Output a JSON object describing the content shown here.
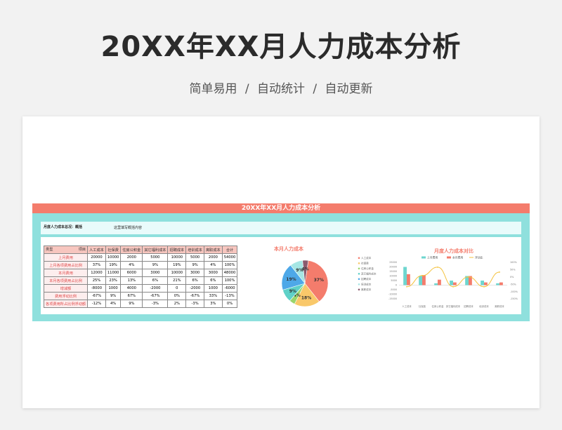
{
  "header": {
    "title": "20XX年XX月人力成本分析",
    "subtitle": "简单易用 / 自动统计 / 自动更新"
  },
  "sheet": {
    "title": "20XX年XX月人力成本分析",
    "summary_label": "月度人力成本总况：概括",
    "summary_value": "这里填写概括内容"
  },
  "table": {
    "corner_left": "类型",
    "corner_right": "项目",
    "columns": [
      "人工成本",
      "社保费",
      "住房公积金",
      "其它福利成本",
      "招聘成本",
      "培训成本",
      "离职成本",
      "合计"
    ],
    "rows": [
      {
        "label": "上月费用",
        "cells": [
          "20000",
          "10000",
          "2000",
          "5000",
          "10000",
          "5000",
          "2000",
          "54000"
        ]
      },
      {
        "label": "上月各项费用占比例",
        "cells": [
          "37%",
          "19%",
          "4%",
          "9%",
          "19%",
          "9%",
          "4%",
          "100%"
        ]
      },
      {
        "label": "本月费用",
        "cells": [
          "12000",
          "11000",
          "6000",
          "3000",
          "10000",
          "3000",
          "3000",
          "48000"
        ]
      },
      {
        "label": "本月各项费用占比例",
        "cells": [
          "25%",
          "23%",
          "13%",
          "6%",
          "21%",
          "6%",
          "6%",
          "100%"
        ]
      },
      {
        "label": "增减额",
        "cells": [
          "-8000",
          "1000",
          "4000",
          "-2000",
          "0",
          "-2000",
          "1000",
          "-6000"
        ]
      },
      {
        "label": "费用浮动比例",
        "cells": [
          "-67%",
          "9%",
          "67%",
          "-67%",
          "0%",
          "-67%",
          "33%",
          "-13%"
        ]
      },
      {
        "label": "各项费用所占比例浮动额",
        "cells": [
          "-12%",
          "4%",
          "9%",
          "-3%",
          "2%",
          "-3%",
          "3%",
          "0%"
        ]
      }
    ]
  },
  "chart_data": [
    {
      "type": "pie",
      "title": "本月人力成本",
      "categories": [
        "人工成本",
        "社保费",
        "住房公积金",
        "其它福利成本",
        "招聘成本",
        "培训成本",
        "离职成本"
      ],
      "values": [
        37,
        18,
        4,
        9,
        19,
        9,
        4
      ],
      "labels": [
        "37%",
        "18%",
        "4%",
        "9%",
        "19%",
        "9%",
        "4%"
      ],
      "colors": [
        "#f47c6c",
        "#f9c86a",
        "#9ad56b",
        "#5fd1c8",
        "#4ea8e8",
        "#a6e6e4",
        "#8a5a6e"
      ]
    },
    {
      "type": "bar",
      "title": "月度人力成本对比",
      "categories": [
        "人工成本",
        "社保费",
        "住房公积金",
        "其它福利成本",
        "招聘成本",
        "培训成本",
        "离职成本"
      ],
      "series": [
        {
          "name": "上月费用",
          "values": [
            20000,
            10000,
            2000,
            5000,
            10000,
            5000,
            2000
          ],
          "color": "#6ed6cf"
        },
        {
          "name": "本月费用",
          "values": [
            12000,
            11000,
            6000,
            3000,
            10000,
            3000,
            3000
          ],
          "color": "#f47c6c"
        },
        {
          "name": "浮动比",
          "type": "line",
          "values": [
            -67,
            9,
            67,
            -67,
            0,
            -67,
            33
          ],
          "color": "#f4c23d"
        }
      ],
      "left_ticks": [
        "25000",
        "20000",
        "15000",
        "10000",
        "5000",
        "0",
        "-5000",
        "-10000",
        "-15000"
      ],
      "right_ticks": [
        "100%",
        "50%",
        "0%",
        "-50%",
        "-100%",
        "-150%"
      ],
      "ylim": [
        -15000,
        25000
      ],
      "y2lim": [
        -150,
        100
      ],
      "legend": "top"
    }
  ]
}
